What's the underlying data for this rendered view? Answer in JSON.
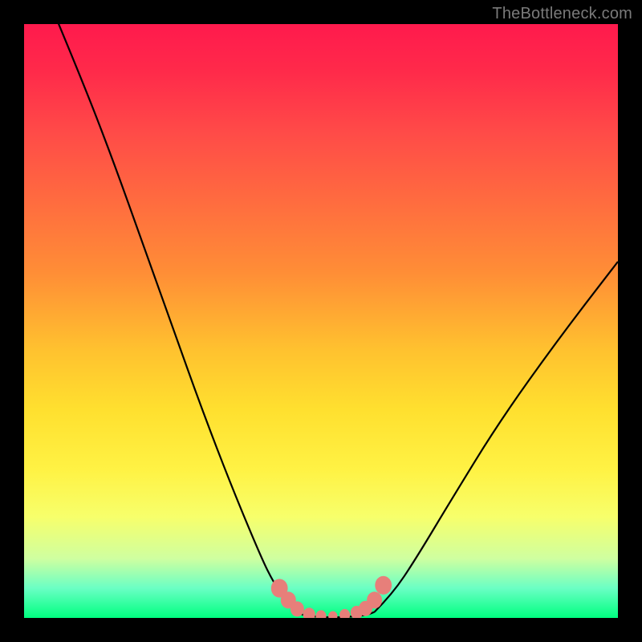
{
  "watermark": "TheBottleneck.com",
  "chart_data": {
    "type": "line",
    "title": "",
    "xlabel": "",
    "ylabel": "",
    "xlim": [
      0,
      100
    ],
    "ylim": [
      0,
      100
    ],
    "grid": false,
    "legend": false,
    "series": [
      {
        "name": "left-curve",
        "x": [
          5,
          10,
          15,
          20,
          25,
          30,
          35,
          40,
          42,
          44,
          46,
          47
        ],
        "y": [
          102,
          90,
          77,
          63,
          49,
          35,
          22,
          10,
          6,
          3,
          1,
          0.5
        ]
      },
      {
        "name": "bottom-segment",
        "x": [
          47,
          49,
          51,
          53,
          55,
          57,
          58,
          59
        ],
        "y": [
          0.5,
          0.2,
          0.1,
          0.1,
          0.2,
          0.4,
          0.6,
          1.0
        ]
      },
      {
        "name": "right-curve",
        "x": [
          59,
          62,
          66,
          72,
          80,
          90,
          100
        ],
        "y": [
          1.0,
          4,
          10,
          20,
          33,
          47,
          60
        ]
      }
    ],
    "markers": {
      "name": "highlight-points",
      "x": [
        43.0,
        44.5,
        46.0,
        48.0,
        50.0,
        52.0,
        54.0,
        56.0,
        57.5,
        59.0,
        60.5
      ],
      "y": [
        5.0,
        3.0,
        1.5,
        0.6,
        0.3,
        0.3,
        0.5,
        0.9,
        1.6,
        3.0,
        5.5
      ]
    },
    "colors": {
      "gradient_top": "#ff1a4d",
      "gradient_mid": "#ffe02f",
      "gradient_bottom": "#00ff80",
      "curve": "#000000",
      "marker": "#e77f7a",
      "frame": "#000000"
    }
  }
}
